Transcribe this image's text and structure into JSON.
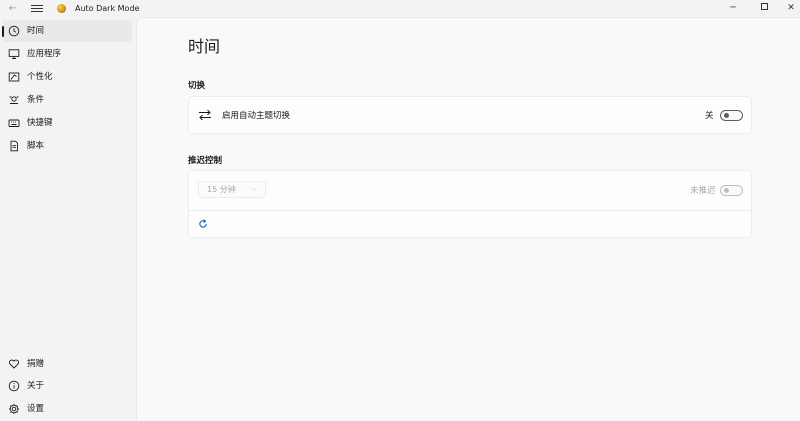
{
  "window": {
    "title": "Auto Dark Mode",
    "back_icon": "arrow-left-icon",
    "menu_icon": "hamburger-icon",
    "minimize": "─",
    "close": "✕"
  },
  "sidebar": {
    "top_items": [
      {
        "label": "时间",
        "icon": "clock-icon",
        "selected": true
      },
      {
        "label": "应用程序",
        "icon": "monitor-icon",
        "selected": false
      },
      {
        "label": "个性化",
        "icon": "paint-icon",
        "selected": false
      },
      {
        "label": "条件",
        "icon": "conditions-icon",
        "selected": false
      },
      {
        "label": "快捷键",
        "icon": "keyboard-icon",
        "selected": false
      },
      {
        "label": "脚本",
        "icon": "script-icon",
        "selected": false
      }
    ],
    "bottom_items": [
      {
        "label": "捐赠",
        "icon": "heart-icon"
      },
      {
        "label": "关于",
        "icon": "info-icon"
      },
      {
        "label": "设置",
        "icon": "gear-icon"
      }
    ]
  },
  "main": {
    "title": "时间",
    "switch_section": {
      "label": "切换",
      "row_label": "启用自动主题切换",
      "toggle_state_label": "关",
      "toggle_on": false
    },
    "postpone_section": {
      "label": "推迟控制",
      "dropdown_value": "15 分钟",
      "toggle_state_label": "未推迟",
      "toggle_on": false
    }
  },
  "colors": {
    "sidebar_bg": "#f3f3f3",
    "content_bg": "#f9f9f9",
    "refresh_icon": "#1a5fb4"
  }
}
